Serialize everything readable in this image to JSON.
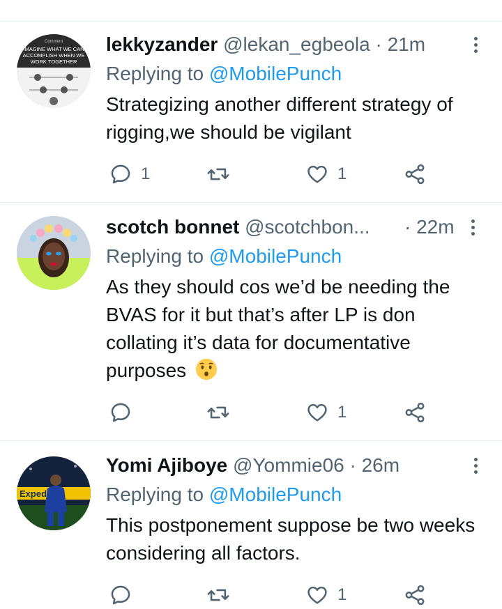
{
  "tweets": [
    {
      "name": "lekkyzander",
      "handle": "@lekan_egbeola",
      "separator": "·",
      "time": "21m",
      "replying_prefix": "Replying to",
      "replying_to": "@MobilePunch",
      "text": "Strategizing another different strategy of rigging,we should be vigilant",
      "replies": "1",
      "retweets": "",
      "likes": "1",
      "avatar_caption": [
        "Comment",
        "IMAGINE WHAT WE CAN",
        "ACCOMPLISH WHEN WE",
        "WORK TOGETHER"
      ]
    },
    {
      "name": "scotch bonnet",
      "handle": "@scotchbon...",
      "separator": "·",
      "time": "22m",
      "replying_prefix": "Replying to",
      "replying_to": "@MobilePunch",
      "text": "As they should cos we’d be needing the BVAS for it but that’s after LP is don collating it’s data for documentative purposes",
      "emoji": "hushed-face-emoji",
      "replies": "",
      "retweets": "",
      "likes": "1"
    },
    {
      "name": "Yomi Ajiboye",
      "handle": "@Yommie06",
      "separator": "·",
      "time": "26m",
      "replying_prefix": "Replying to",
      "replying_to": "@MobilePunch",
      "text": "This postponement suppose be two weeks considering all factors.",
      "replies": "",
      "retweets": "",
      "likes": "1",
      "avatar_caption": [
        "Expedia"
      ]
    }
  ],
  "icons": {
    "reply": "speech-bubble-icon",
    "retweet": "retweet-icon",
    "like": "heart-icon",
    "share": "share-icon",
    "more": "more-vertical-icon"
  },
  "colors": {
    "text": "#0f1419",
    "secondary": "#536471",
    "link": "#1d9bf0",
    "divider": "#e6ecf0"
  }
}
